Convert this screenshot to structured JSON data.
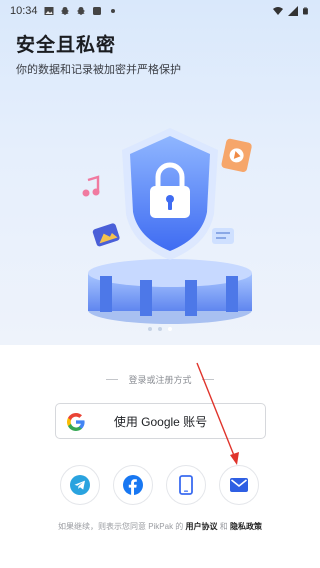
{
  "status_bar": {
    "time": "10:34"
  },
  "hero": {
    "title": "安全且私密",
    "subtitle": "你的数据和记录被加密并严格保护"
  },
  "carousel": {
    "current_page": 3,
    "total_pages": 3
  },
  "login": {
    "divider_text": "登录或注册方式",
    "google_button_label": "使用 Google 账号",
    "social_buttons": [
      "telegram",
      "facebook",
      "phone",
      "email"
    ]
  },
  "terms": {
    "prefix": "如果继续，则表示您同意 PikPak 的",
    "user_agreement": "用户协议",
    "and": "和",
    "privacy_policy": "隐私政策"
  },
  "colors": {
    "accent_blue": "#3b6cf0",
    "annotation_red": "#e0342c",
    "telegram_blue": "#2aa3df",
    "facebook_blue": "#1877f2"
  }
}
